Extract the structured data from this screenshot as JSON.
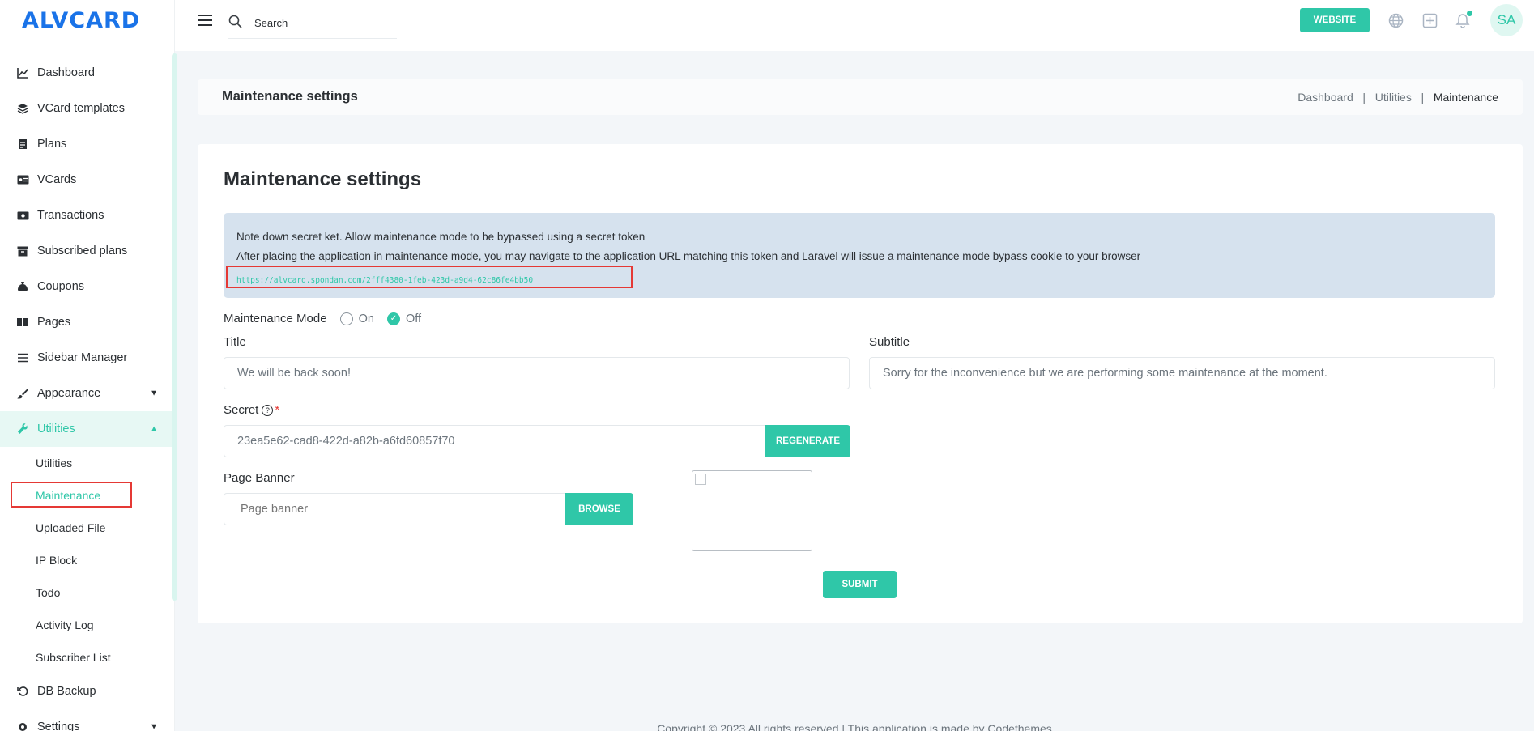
{
  "brand": {
    "logo_text": "ALVCARD"
  },
  "sidebar": {
    "items": [
      {
        "label": "Dashboard",
        "icon": "chart-line-icon"
      },
      {
        "label": "VCard templates",
        "icon": "layers-icon"
      },
      {
        "label": "Plans",
        "icon": "file-icon"
      },
      {
        "label": "VCards",
        "icon": "id-card-icon"
      },
      {
        "label": "Transactions",
        "icon": "money-icon"
      },
      {
        "label": "Subscribed plans",
        "icon": "archive-icon"
      },
      {
        "label": "Coupons",
        "icon": "money-bag-icon"
      },
      {
        "label": "Pages",
        "icon": "book-icon"
      },
      {
        "label": "Sidebar Manager",
        "icon": "list-icon"
      },
      {
        "label": "Appearance",
        "icon": "brush-icon"
      },
      {
        "label": "Utilities",
        "icon": "wrench-icon"
      }
    ],
    "sub_items": [
      {
        "label": "Utilities"
      },
      {
        "label": "Maintenance"
      },
      {
        "label": "Uploaded File"
      },
      {
        "label": "IP Block"
      },
      {
        "label": "Todo"
      },
      {
        "label": "Activity Log"
      },
      {
        "label": "Subscriber List"
      }
    ],
    "after_items": [
      {
        "label": "DB Backup",
        "icon": "undo-icon"
      },
      {
        "label": "Settings",
        "icon": "settings-icon"
      }
    ]
  },
  "topbar": {
    "search_placeholder": "Search",
    "website_label": "WEBSITE",
    "avatar_initials": "SA"
  },
  "header": {
    "title": "Maintenance settings",
    "breadcrumb": [
      "Dashboard",
      "Utilities",
      "Maintenance"
    ],
    "separator": "|"
  },
  "main": {
    "title": "Maintenance settings",
    "alert": {
      "line1": "Note down secret ket. Allow maintenance mode to be bypassed using a secret token",
      "line2": "After placing the application in maintenance mode, you may navigate to the application URL matching this token and Laravel will issue a maintenance mode bypass cookie to your browser",
      "url": "https://alvcard.spondan.com/2fff4380-1feb-423d-a9d4-62c86fe4bb50"
    },
    "mode": {
      "label": "Maintenance Mode",
      "on_label": "On",
      "off_label": "Off",
      "selected": "Off"
    },
    "title_field": {
      "label": "Title",
      "value": "We will be back soon!"
    },
    "subtitle_field": {
      "label": "Subtitle",
      "value": "Sorry for the inconvenience but we are performing some maintenance at the moment."
    },
    "secret_field": {
      "label": "Secret",
      "required_mark": "*",
      "help_glyph": "?",
      "value": "23ea5e62-cad8-422d-a82b-a6fd60857f70",
      "regenerate_label": "REGENERATE"
    },
    "banner_field": {
      "label": "Page Banner",
      "placeholder": "Page banner",
      "browse_label": "BROWSE"
    },
    "submit_label": "SUBMIT"
  },
  "footer": {
    "text": "Copyright © 2023 All rights reserved | This application is made by Codethemes"
  },
  "colors": {
    "accent": "#2fc7a8",
    "brand": "#1a73e8",
    "alert_bg": "#d6e2ee",
    "highlight": "#e53935"
  }
}
